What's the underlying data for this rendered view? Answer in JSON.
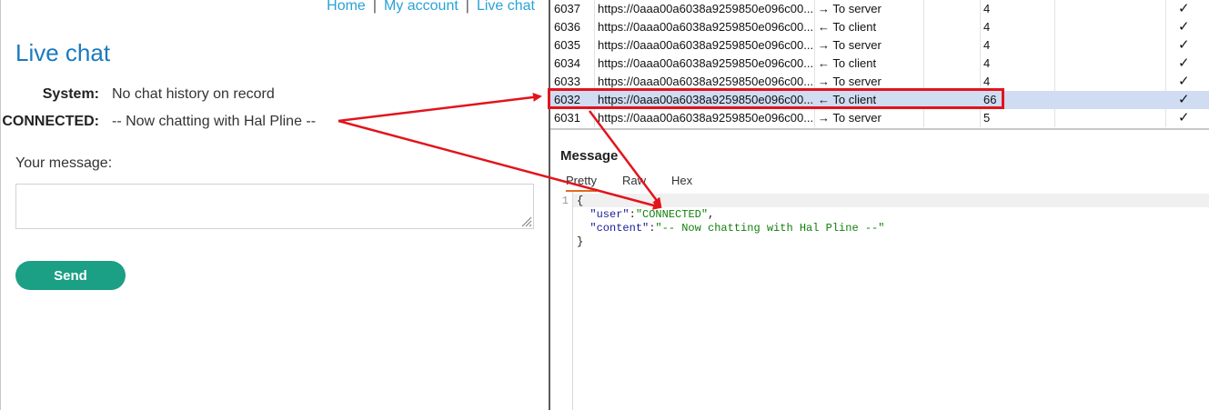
{
  "nav": {
    "home": "Home",
    "account": "My account",
    "livechat": "Live chat",
    "sep": "|"
  },
  "page": {
    "title": "Live chat"
  },
  "chat": [
    {
      "who": "System:",
      "msg": "No chat history on record"
    },
    {
      "who": "CONNECTED:",
      "msg": "-- Now chatting with Hal Pline --"
    }
  ],
  "form": {
    "label": "Your message:",
    "value": "",
    "send": "Send"
  },
  "ws_rows": [
    {
      "id": "6037",
      "url": "https://0aaa00a6038a9259850e096c00...",
      "dir": "→ To server",
      "len": "4",
      "check": "✓"
    },
    {
      "id": "6036",
      "url": "https://0aaa00a6038a9259850e096c00...",
      "dir": "← To client",
      "len": "4",
      "check": "✓"
    },
    {
      "id": "6035",
      "url": "https://0aaa00a6038a9259850e096c00...",
      "dir": "→ To server",
      "len": "4",
      "check": "✓"
    },
    {
      "id": "6034",
      "url": "https://0aaa00a6038a9259850e096c00...",
      "dir": "← To client",
      "len": "4",
      "check": "✓"
    },
    {
      "id": "6033",
      "url": "https://0aaa00a6038a9259850e096c00...",
      "dir": "→ To server",
      "len": "4",
      "check": "✓"
    },
    {
      "id": "6032",
      "url": "https://0aaa00a6038a9259850e096c00...",
      "dir": "← To client",
      "len": "66",
      "check": "✓",
      "selected": true
    },
    {
      "id": "6031",
      "url": "https://0aaa00a6038a9259850e096c00...",
      "dir": "→ To server",
      "len": "5",
      "check": "✓"
    }
  ],
  "message": {
    "title": "Message",
    "tabs": [
      "Pretty",
      "Raw",
      "Hex"
    ],
    "active_tab": "Pretty",
    "line_number": "1",
    "code": {
      "open": "{",
      "key1": "\"user\"",
      "val1": "\"CONNECTED\"",
      "key2": "\"content\"",
      "val2": "\"-- Now chatting with Hal Pline --\"",
      "close": "}"
    }
  },
  "colors": {
    "highlight": "#e2141c",
    "accent": "#1a7abf",
    "button": "#1b9f85",
    "selection": "#cfdcf2"
  }
}
